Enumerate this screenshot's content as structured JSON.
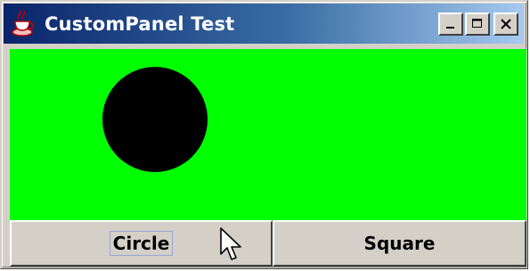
{
  "window": {
    "title": "CustomPanel Test",
    "controls": [
      "minimize",
      "maximize",
      "close"
    ]
  },
  "panel": {
    "background_color": "#00ff00",
    "shape": "circle",
    "shape_color": "#000000"
  },
  "buttons": {
    "circle_label": "Circle",
    "square_label": "Square",
    "focused": "circle"
  },
  "colors": {
    "titlebar_start": "#0a246a",
    "titlebar_end": "#a6caf0",
    "chrome": "#d4d0c8"
  },
  "icons": {
    "app": "java-coffee-icon",
    "minimize": "minimize-icon",
    "maximize": "maximize-icon",
    "close": "close-icon",
    "cursor": "mouse-pointer-icon"
  }
}
